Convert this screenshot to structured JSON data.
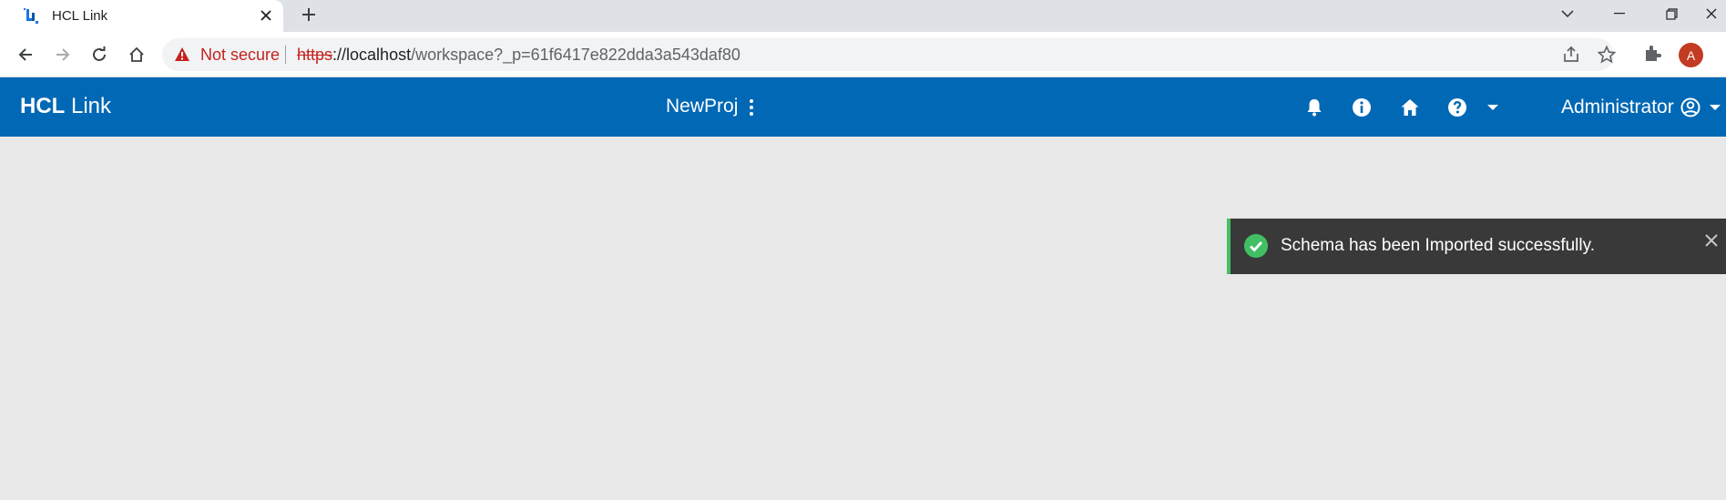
{
  "browser": {
    "tab": {
      "title": "HCL Link"
    },
    "address": {
      "security_label": "Not secure",
      "url_scheme": "https",
      "url_host": "://localhost",
      "url_path": "/workspace?_p=61f6417e822dda3a543daf80"
    },
    "profile_initial": "A"
  },
  "app": {
    "brand_bold": "HCL",
    "brand_light": "Link",
    "project_name": "NewProj",
    "user_name": "Administrator",
    "header_color": "#0068b5"
  },
  "toast": {
    "message": "Schema has been Imported successfully.",
    "status": "success",
    "accent_color": "#42be65"
  },
  "icons": {
    "header": [
      "bell-icon",
      "info-icon",
      "home-icon",
      "help-icon",
      "chevron-down-icon",
      "user-circle-icon"
    ],
    "browser": [
      "back-icon",
      "forward-icon",
      "reload-icon",
      "home-icon",
      "share-icon",
      "star-icon",
      "extensions-icon"
    ]
  }
}
